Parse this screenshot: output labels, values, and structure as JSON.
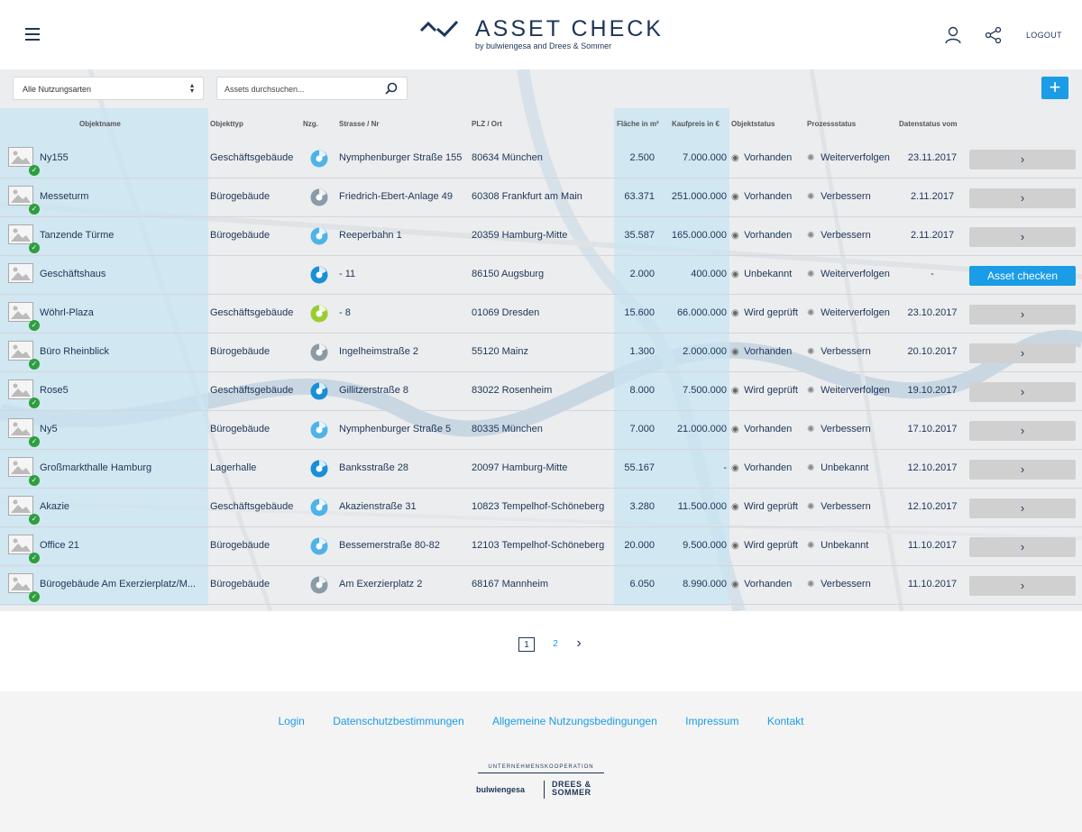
{
  "header": {
    "logo_text": "ASSET CHECK",
    "logo_sub": "by bulwiengesa and Drees & Sommer",
    "logout_label": "LOGOUT"
  },
  "filters": {
    "usage_select": "Alle Nutzungsarten",
    "search_placeholder": "Assets durchsuchen...",
    "add_label": "+"
  },
  "table": {
    "columns": {
      "name": "Objektname",
      "type": "Objekttyp",
      "nzg": "Nzg.",
      "street": "Strasse / Nr",
      "plz": "PLZ / Ort",
      "flaeche": "Fläche in m²",
      "preis": "Kaufpreis in €",
      "status": "Objektstatus",
      "process": "Prozessstatus",
      "date": "Datenstatus vom"
    },
    "rows": [
      {
        "name": "Ny155",
        "type": "Geschäftsgebäude",
        "street": "Nymphenburger Straße 155",
        "plz": "80634 München",
        "flaeche": "2.500",
        "preis": "7.000.000",
        "status": "Vorhanden",
        "process": "Weiterverfolgen",
        "date": "23.11.2017",
        "action": "›",
        "checked": true,
        "pie": "#4fb3e8"
      },
      {
        "name": "Messeturm",
        "type": "Bürogebäude",
        "street": "Friedrich-Ebert-Anlage 49",
        "plz": "60308 Frankfurt am Main",
        "flaeche": "63.371",
        "preis": "251.000.000",
        "status": "Vorhanden",
        "process": "Verbessern",
        "date": "2.11.2017",
        "action": "›",
        "checked": true,
        "pie": "#8a9ba8"
      },
      {
        "name": "Tanzende Türme",
        "type": "Bürogebäude",
        "street": "Reeperbahn 1",
        "plz": "20359 Hamburg-Mitte",
        "flaeche": "35.587",
        "preis": "165.000.000",
        "status": "Vorhanden",
        "process": "Verbessern",
        "date": "2.11.2017",
        "action": "›",
        "checked": true,
        "pie": "#4fb3e8"
      },
      {
        "name": "Geschäftshaus",
        "type": "",
        "street": "- 11",
        "plz": "86150 Augsburg",
        "flaeche": "2.000",
        "preis": "400.000",
        "status": "Unbekannt",
        "process": "Weiterverfolgen",
        "date": "-",
        "action": "Asset checken",
        "checked": false,
        "pie": "#1a8fd6"
      },
      {
        "name": "Wöhrl-Plaza",
        "type": "Geschäftsgebäude",
        "street": "- 8",
        "plz": "01069 Dresden",
        "flaeche": "15.600",
        "preis": "66.000.000",
        "status": "Wird geprüft",
        "process": "Weiterverfolgen",
        "date": "23.10.2017",
        "action": "›",
        "checked": true,
        "pie": "#9acd32"
      },
      {
        "name": "Büro Rheinblick",
        "type": "Bürogebäude",
        "street": "Ingelheimstraße 2",
        "plz": "55120 Mainz",
        "flaeche": "1.300",
        "preis": "2.000.000",
        "status": "Vorhanden",
        "process": "Verbessern",
        "date": "20.10.2017",
        "action": "›",
        "checked": true,
        "pie": "#8a9ba8"
      },
      {
        "name": "Rose5",
        "type": "Geschäftsgebäude",
        "street": "Gillitzerstraße 8",
        "plz": "83022 Rosenheim",
        "flaeche": "8.000",
        "preis": "7.500.000",
        "status": "Wird geprüft",
        "process": "Weiterverfolgen",
        "date": "19.10.2017",
        "action": "›",
        "checked": true,
        "pie": "#1a8fd6"
      },
      {
        "name": "Ny5",
        "type": "Bürogebäude",
        "street": "Nymphenburger Straße 5",
        "plz": "80335 München",
        "flaeche": "7.000",
        "preis": "21.000.000",
        "status": "Vorhanden",
        "process": "Verbessern",
        "date": "17.10.2017",
        "action": "›",
        "checked": true,
        "pie": "#4fb3e8"
      },
      {
        "name": "Großmarkthalle Hamburg",
        "type": "Lagerhalle",
        "street": "Banksstraße 28",
        "plz": "20097 Hamburg-Mitte",
        "flaeche": "55.167",
        "preis": "-",
        "status": "Vorhanden",
        "process": "Unbekannt",
        "date": "12.10.2017",
        "action": "›",
        "checked": true,
        "pie": "#1a8fd6"
      },
      {
        "name": "Akazie",
        "type": "Geschäftsgebäude",
        "street": "Akazienstraße 31",
        "plz": "10823 Tempelhof-Schöneberg",
        "flaeche": "3.280",
        "preis": "11.500.000",
        "status": "Wird geprüft",
        "process": "Verbessern",
        "date": "12.10.2017",
        "action": "›",
        "checked": true,
        "pie": "#4fb3e8"
      },
      {
        "name": "Office 21",
        "type": "Bürogebäude",
        "street": "Bessemerstraße 80-82",
        "plz": "12103 Tempelhof-Schöneberg",
        "flaeche": "20.000",
        "preis": "9.500.000",
        "status": "Wird geprüft",
        "process": "Unbekannt",
        "date": "11.10.2017",
        "action": "›",
        "checked": true,
        "pie": "#4fb3e8"
      },
      {
        "name": "Bürogebäude Am Exerzierplatz/M...",
        "type": "Bürogebäude",
        "street": "Am Exerzierplatz 2",
        "plz": "68167 Mannheim",
        "flaeche": "6.050",
        "preis": "8.990.000",
        "status": "Vorhanden",
        "process": "Verbessern",
        "date": "11.10.2017",
        "action": "›",
        "checked": true,
        "pie": "#8a9ba8"
      }
    ]
  },
  "pagination": {
    "pages": [
      "1",
      "2"
    ],
    "active": "1",
    "next": "›"
  },
  "footer": {
    "links": [
      "Login",
      "Datenschutzbestimmungen",
      "Allgemeine Nutzungsbedingungen",
      "Impressum",
      "Kontakt"
    ],
    "coop_label": "UNTERNEHMENSKOOPERATION",
    "bw_logo": "bulwiengesa",
    "ds_logo_1": "DREES &",
    "ds_logo_2": "SOMMER"
  }
}
